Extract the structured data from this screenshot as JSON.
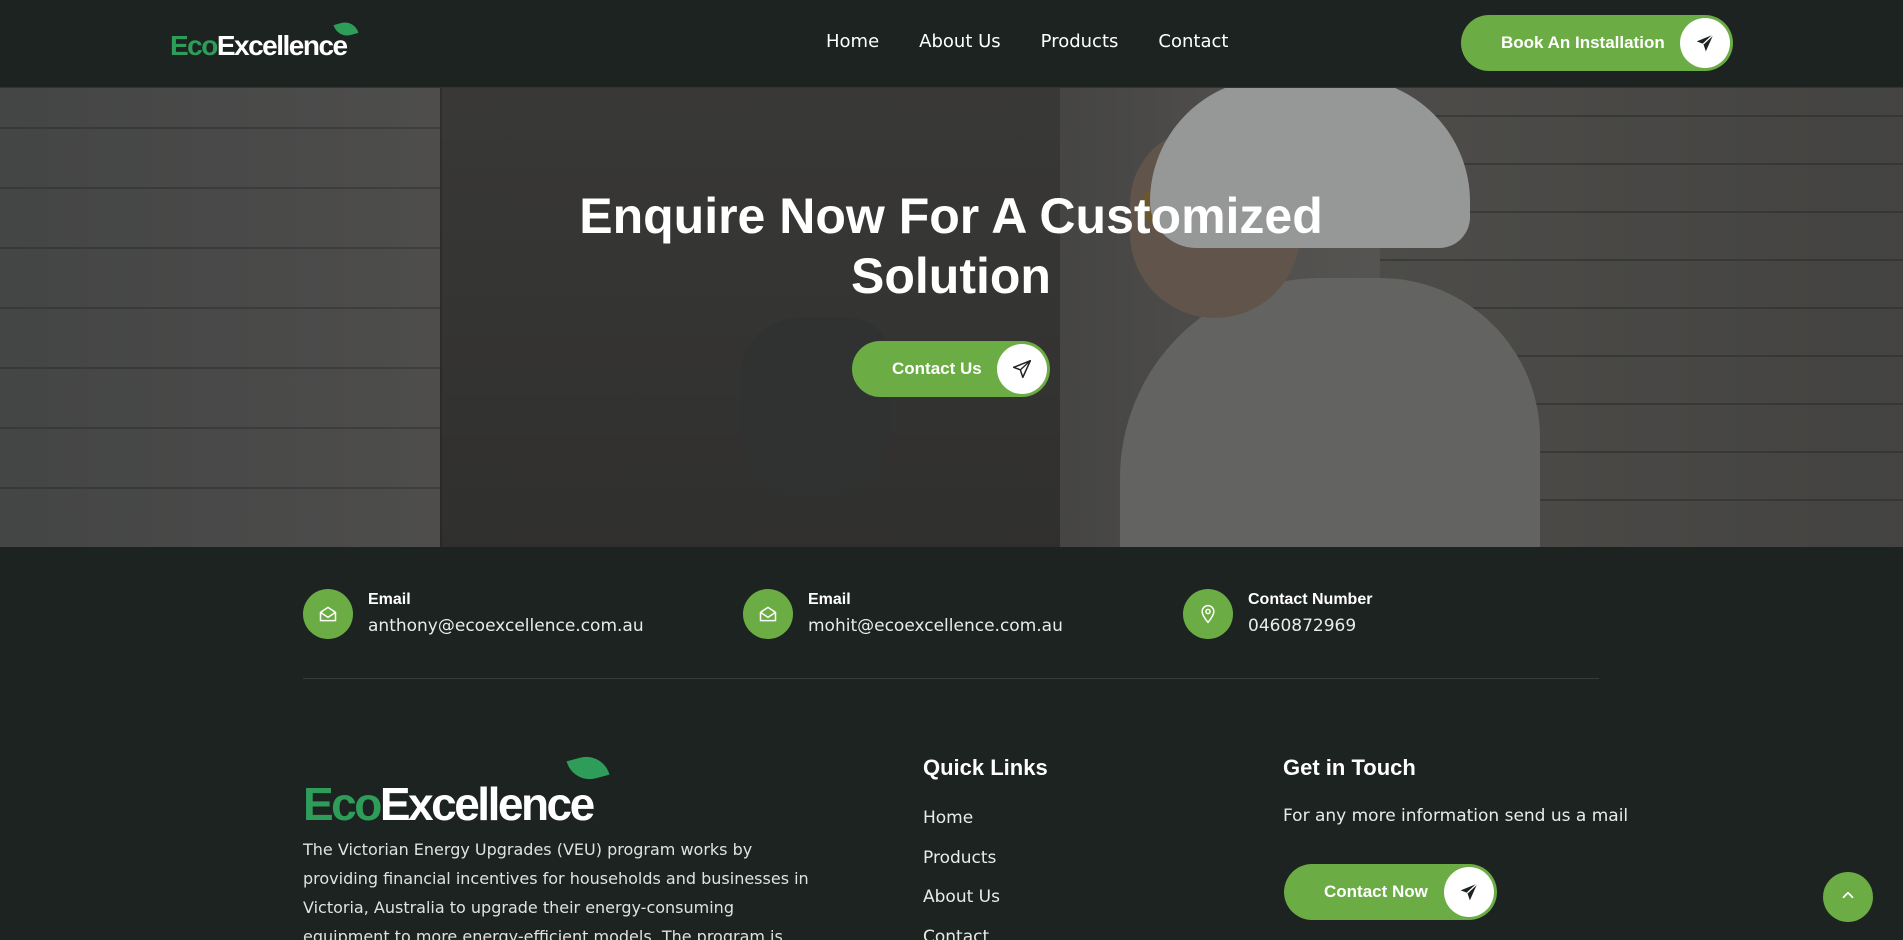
{
  "header": {
    "logo": {
      "part1": "Eco",
      "part2": "Excellence"
    },
    "nav": [
      "Home",
      "About Us",
      "Products",
      "Contact"
    ],
    "cta_label": "Book An Installation",
    "cta_icon": "paper-plane-icon"
  },
  "hero": {
    "title_line1": "Enquire Now For A Customized",
    "title_line2": "Solution",
    "button_label": "Contact Us",
    "button_icon": "paper-plane-icon"
  },
  "contact_info": [
    {
      "icon": "envelope-open-icon",
      "title": "Email",
      "value": "anthony@ecoexcellence.com.au"
    },
    {
      "icon": "envelope-open-icon",
      "title": "Email",
      "value": "mohit@ecoexcellence.com.au"
    },
    {
      "icon": "map-pin-icon",
      "title": "Contact Number",
      "value": "0460872969"
    }
  ],
  "footer": {
    "logo": {
      "part1": "Eco",
      "part2": "Excellence"
    },
    "description": "The Victorian Energy Upgrades (VEU) program works by providing financial incentives for households and businesses in Victoria, Australia to upgrade their energy-consuming equipment to more energy-efficient models. The program is designed to reduce",
    "quick_links": {
      "title": "Quick Links",
      "items": [
        "Home",
        "Products",
        "About Us",
        "Contact"
      ]
    },
    "get_in_touch": {
      "title": "Get in Touch",
      "text": "For any more information send us a mail",
      "button_label": "Contact Now",
      "button_icon": "paper-plane-icon"
    }
  },
  "scroll_top_icon": "chevron-up-icon",
  "colors": {
    "background": "#1c2320",
    "accent_green": "#6bac44",
    "logo_green": "#2e9d5a",
    "text": "#ffffff"
  }
}
